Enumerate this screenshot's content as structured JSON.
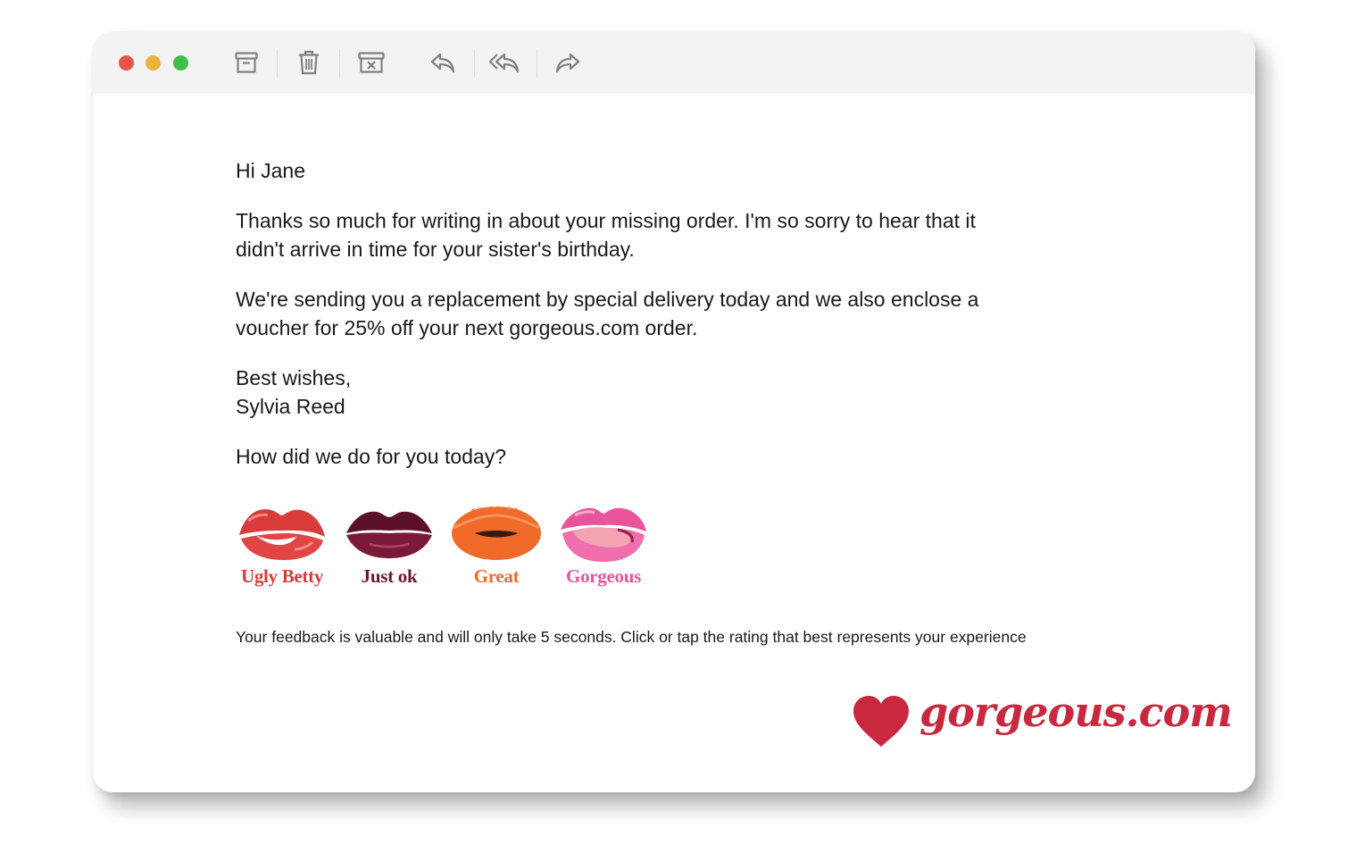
{
  "window": {
    "traffic_lights": {
      "close_color": "#e4564c",
      "minimize_color": "#ecb33a",
      "zoom_color": "#3fbf49"
    },
    "toolbar": {
      "icons": [
        "archive-icon",
        "trash-icon",
        "junk-icon",
        "reply-icon",
        "reply-all-icon",
        "forward-icon"
      ],
      "icon_color": "#808080"
    }
  },
  "email": {
    "greeting": "Hi Jane",
    "paragraph1_line1": "Thanks so much for writing in about your missing order. I'm so sorry to hear that it",
    "paragraph1_line2": "didn't arrive in time for your sister's birthday.",
    "paragraph2_line1": "We're sending you a replacement by special delivery today and we also enclose a",
    "paragraph2_line2": "voucher for 25% off your next gorgeous.com order.",
    "signoff": "Best wishes,",
    "signature": "Sylvia Reed",
    "question": "How did we do for you today?"
  },
  "ratings": [
    {
      "label": "Ugly Betty",
      "color": "#d93b3b"
    },
    {
      "label": "Just ok",
      "color": "#6e1530"
    },
    {
      "label": "Great",
      "color": "#f06a2a"
    },
    {
      "label": "Gorgeous",
      "color": "#e8559b"
    }
  ],
  "feedback_note": "Your feedback is valuable and will only take 5 seconds. Click or tap the rating that best represents your experience",
  "brand": {
    "logo_text": "gorgeous.com",
    "color": "#c8293f"
  }
}
